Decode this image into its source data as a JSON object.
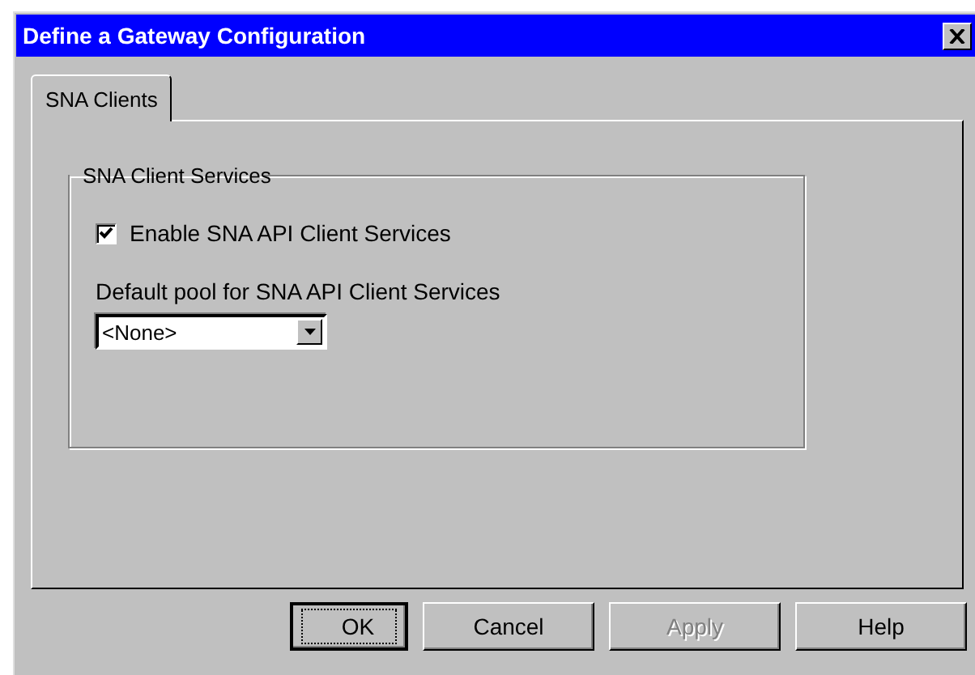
{
  "window": {
    "title": "Define a Gateway Configuration"
  },
  "tabs": [
    {
      "label": "SNA Clients",
      "selected": true
    }
  ],
  "group": {
    "title": "SNA Client Services",
    "checkbox": {
      "label": "Enable SNA API Client Services",
      "checked": true
    },
    "pool": {
      "label": "Default pool for SNA API Client Services",
      "value": "<None>"
    }
  },
  "buttons": [
    {
      "label": "OK",
      "default": true,
      "disabled": false
    },
    {
      "label": "Cancel",
      "default": false,
      "disabled": false
    },
    {
      "label": "Apply",
      "default": false,
      "disabled": true
    },
    {
      "label": "Help",
      "default": false,
      "disabled": false
    }
  ]
}
